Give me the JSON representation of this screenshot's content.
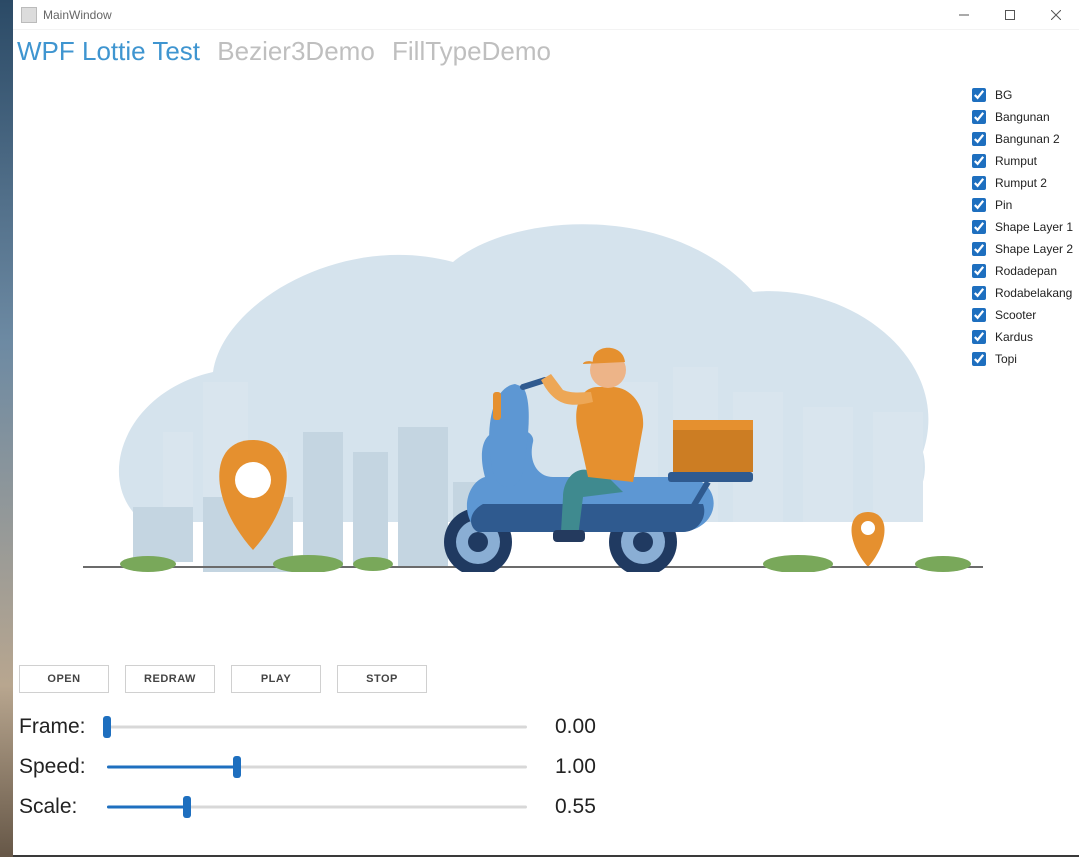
{
  "window": {
    "title": "MainWindow"
  },
  "tabs": [
    {
      "label": "WPF Lottie Test",
      "active": true
    },
    {
      "label": "Bezier3Demo",
      "active": false
    },
    {
      "label": "FillTypeDemo",
      "active": false
    }
  ],
  "layers": [
    {
      "label": "BG",
      "checked": true
    },
    {
      "label": "Bangunan",
      "checked": true
    },
    {
      "label": "Bangunan 2",
      "checked": true
    },
    {
      "label": "Rumput",
      "checked": true
    },
    {
      "label": "Rumput 2",
      "checked": true
    },
    {
      "label": "Pin",
      "checked": true
    },
    {
      "label": "Shape Layer 1",
      "checked": true
    },
    {
      "label": "Shape Layer 2",
      "checked": true
    },
    {
      "label": "Rodadepan",
      "checked": true
    },
    {
      "label": "Rodabelakang",
      "checked": true
    },
    {
      "label": "Scooter",
      "checked": true
    },
    {
      "label": "Kardus",
      "checked": true
    },
    {
      "label": "Topi",
      "checked": true
    }
  ],
  "buttons": {
    "open": "OPEN",
    "redraw": "REDRAW",
    "play": "PLAY",
    "stop": "STOP"
  },
  "sliders": {
    "frame": {
      "label": "Frame:",
      "value": "0.00",
      "percent": 0
    },
    "speed": {
      "label": "Speed:",
      "value": "1.00",
      "percent": 31
    },
    "scale": {
      "label": "Scale:",
      "value": "0.55",
      "percent": 19
    }
  },
  "colors": {
    "primary": "#1e6fbf",
    "accent_orange": "#e5902f",
    "scooter_blue": "#5d97d3",
    "bg_blob": "#d5e3ed",
    "grass": "#79a85a"
  },
  "debug_icons": [
    "add-event-icon",
    "camera-icon",
    "screen-icon",
    "square-icon",
    "link-icon",
    "refresh-icon",
    "check-icon"
  ]
}
